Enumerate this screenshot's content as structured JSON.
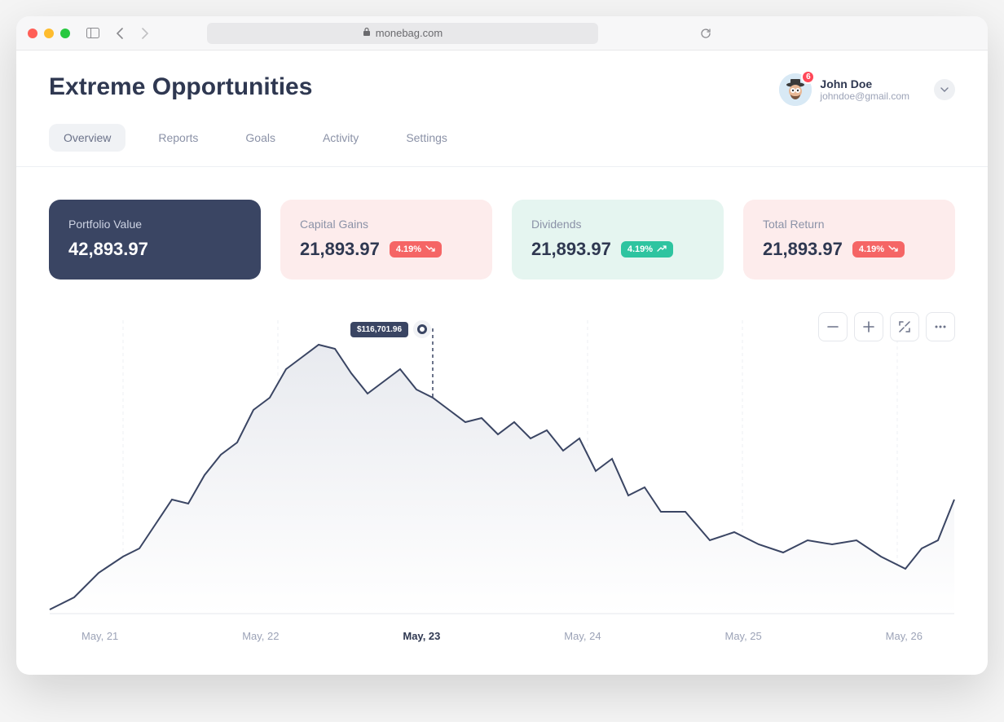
{
  "browser": {
    "url": "monebag.com"
  },
  "header": {
    "title": "Extreme Opportunities",
    "user": {
      "name": "John Doe",
      "email": "johndoe@gmail.com",
      "badge": "6"
    }
  },
  "tabs": [
    {
      "label": "Overview",
      "active": true
    },
    {
      "label": "Reports",
      "active": false
    },
    {
      "label": "Goals",
      "active": false
    },
    {
      "label": "Activity",
      "active": false
    },
    {
      "label": "Settings",
      "active": false
    }
  ],
  "cards": [
    {
      "label": "Portfolio Value",
      "value": "42,893.97",
      "variant": "dark"
    },
    {
      "label": "Capital Gains",
      "value": "21,893.97",
      "variant": "pink",
      "delta": "4.19%",
      "trend": "down"
    },
    {
      "label": "Dividends",
      "value": "21,893.97",
      "variant": "mint",
      "delta": "4.19%",
      "trend": "up"
    },
    {
      "label": "Total Return",
      "value": "21,893.97",
      "variant": "pink",
      "delta": "4.19%",
      "trend": "down"
    }
  ],
  "chart_tooltip": "$116,701.96",
  "x_ticks": [
    "May, 21",
    "May, 22",
    "May, 23",
    "May, 24",
    "May, 25",
    "May, 26"
  ],
  "chart_data": {
    "type": "area",
    "title": "",
    "xlabel": "",
    "ylabel": "",
    "ylim": [
      0,
      160000
    ],
    "highlighted": {
      "x": "May, 23",
      "value": 116701.96
    },
    "x": [
      "May, 20.5",
      "May, 21",
      "May, 21.5",
      "May, 22",
      "May, 22.25",
      "May, 22.5",
      "May, 22.75",
      "May, 23",
      "May, 23.5",
      "May, 24",
      "May, 24.5",
      "May, 25",
      "May, 25.5",
      "May, 26",
      "May, 26.4"
    ],
    "values": [
      5000,
      30000,
      70000,
      110000,
      155000,
      130000,
      142000,
      116702,
      100000,
      90000,
      65000,
      45000,
      45000,
      38000,
      60000
    ],
    "grid_x": true
  }
}
